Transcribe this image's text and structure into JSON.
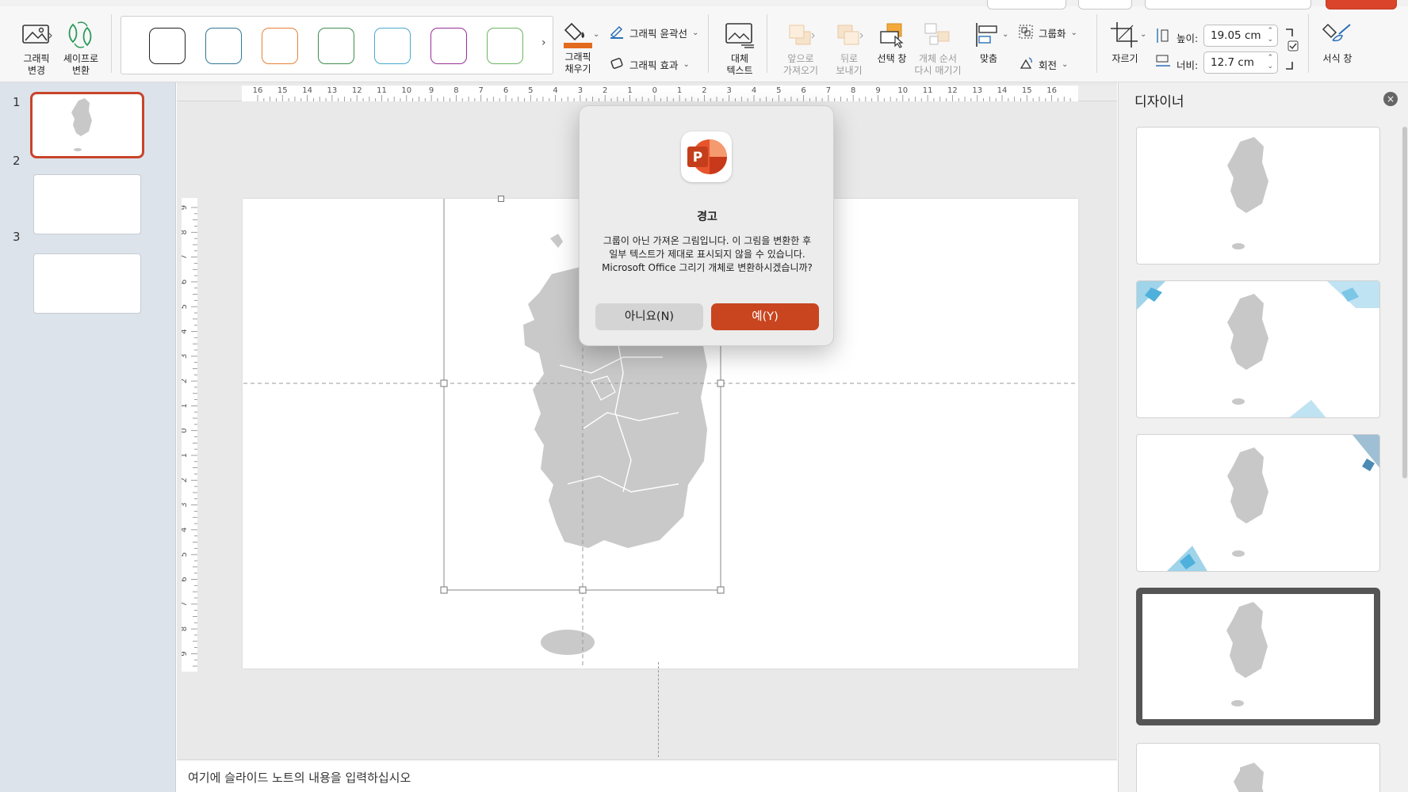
{
  "ribbon": {
    "change_graphic": "그래픽\n변경",
    "convert_to_shape": "셰이프로\n변환",
    "graphic_fill": "그래픽\n채우기",
    "graphic_outline": "그래픽 윤곽선",
    "graphic_effects": "그래픽 효과",
    "alt_text": "대체\n텍스트",
    "bring_forward": "앞으로\n가져오기",
    "send_backward": "뒤로\n보내기",
    "selection_pane": "선택 창",
    "reorder_objects": "개체 순서\n다시 매기기",
    "align": "맞춤",
    "group": "그룹화",
    "rotate": "회전",
    "crop": "자르기",
    "height_label": "높이:",
    "height_value": "19.05 cm",
    "width_label": "너비:",
    "width_value": "12.7 cm",
    "format_pane": "서식 창",
    "style_colors": [
      "#222222",
      "#2f7896",
      "#e7823a",
      "#3f8d4e",
      "#4aa9cf",
      "#9a2f9a",
      "#6bb561"
    ]
  },
  "thumbnails": [
    "1",
    "2",
    "3"
  ],
  "ruler": {
    "h_labels": [
      "16",
      "15",
      "14",
      "13",
      "12",
      "11",
      "10",
      "9",
      "8",
      "7",
      "6",
      "5",
      "4",
      "3",
      "2",
      "1",
      "0",
      "1",
      "2",
      "3",
      "4",
      "5",
      "6",
      "7",
      "8",
      "9",
      "10",
      "11",
      "12",
      "13",
      "14",
      "15",
      "16"
    ],
    "v_labels": [
      "9",
      "8",
      "7",
      "6",
      "5",
      "4",
      "3",
      "2",
      "1",
      "0",
      "1",
      "2",
      "3",
      "4",
      "5",
      "6",
      "7",
      "8",
      "9"
    ]
  },
  "notes_placeholder": "여기에 슬라이드 노트의 내용을 입력하십시오",
  "designer": {
    "title": "디자이너",
    "close": "×",
    "accent_color": "#4fb0db"
  },
  "dialog": {
    "title": "경고",
    "message": "그룹이 아닌 가져온 그림입니다. 이 그림을 변환한 후 일부 텍스트가 제대로 표시되지 않을 수 있습니다. Microsoft Office 그리기 개체로 변환하시겠습니까?",
    "no_button": "아니요(N)",
    "yes_button": "예(Y)",
    "app_icon_letter": "P"
  }
}
